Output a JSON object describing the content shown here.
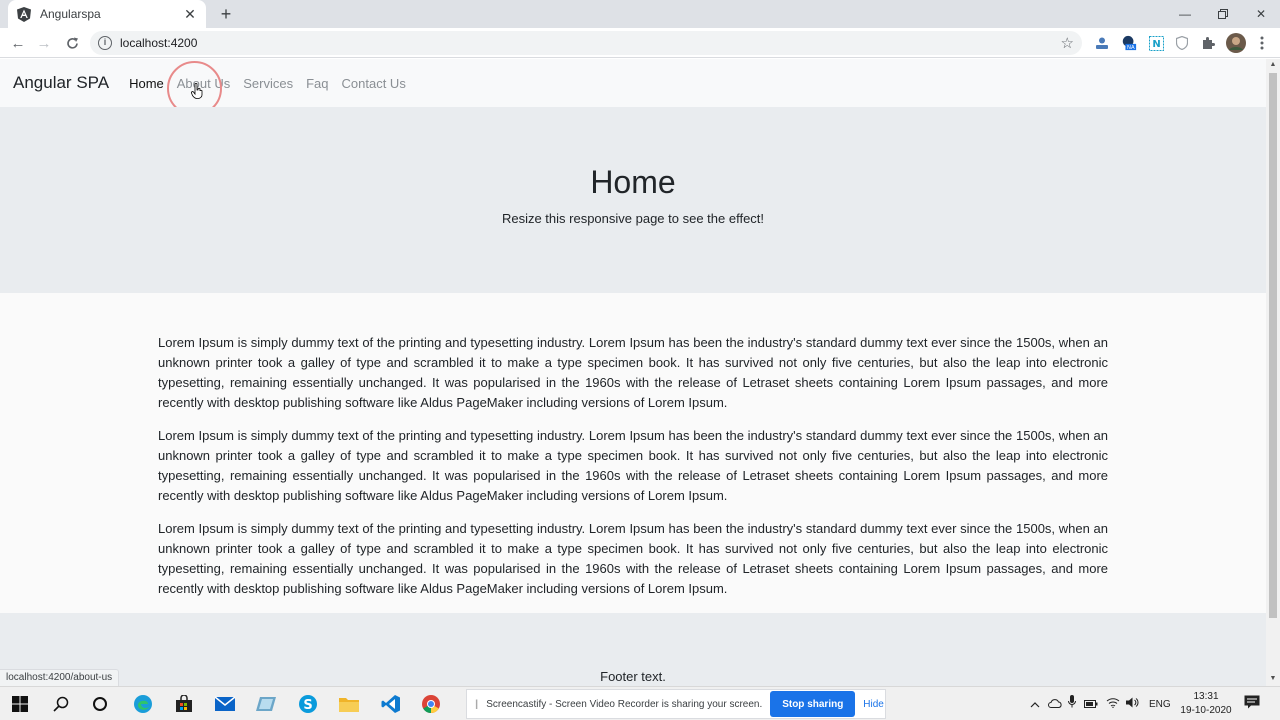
{
  "browser": {
    "tab_title": "Angularspa",
    "url": "localhost:4200",
    "status_url": "localhost:4200/about-us"
  },
  "navbar": {
    "brand": "Angular SPA",
    "links": [
      {
        "label": "Home",
        "active": true
      },
      {
        "label": "About Us",
        "active": false
      },
      {
        "label": "Services",
        "active": false
      },
      {
        "label": "Faq",
        "active": false
      },
      {
        "label": "Contact Us",
        "active": false
      }
    ]
  },
  "hero": {
    "title": "Home",
    "subtitle": "Resize this responsive page to see the effect!"
  },
  "content": {
    "paragraphs": [
      "Lorem Ipsum is simply dummy text of the printing and typesetting industry. Lorem Ipsum has been the industry's standard dummy text ever since the 1500s, when an unknown printer took a galley of type and scrambled it to make a type specimen book. It has survived not only five centuries, but also the leap into electronic typesetting, remaining essentially unchanged. It was popularised in the 1960s with the release of Letraset sheets containing Lorem Ipsum passages, and more recently with desktop publishing software like Aldus PageMaker including versions of Lorem Ipsum.",
      "Lorem Ipsum is simply dummy text of the printing and typesetting industry. Lorem Ipsum has been the industry's standard dummy text ever since the 1500s, when an unknown printer took a galley of type and scrambled it to make a type specimen book. It has survived not only five centuries, but also the leap into electronic typesetting, remaining essentially unchanged. It was popularised in the 1960s with the release of Letraset sheets containing Lorem Ipsum passages, and more recently with desktop publishing software like Aldus PageMaker including versions of Lorem Ipsum.",
      "Lorem Ipsum is simply dummy text of the printing and typesetting industry. Lorem Ipsum has been the industry's standard dummy text ever since the 1500s, when an unknown printer took a galley of type and scrambled it to make a type specimen book. It has survived not only five centuries, but also the leap into electronic typesetting, remaining essentially unchanged. It was popularised in the 1960s with the release of Letraset sheets containing Lorem Ipsum passages, and more recently with desktop publishing software like Aldus PageMaker including versions of Lorem Ipsum."
    ]
  },
  "footer": {
    "text": "Footer text."
  },
  "screen_share": {
    "message": "Screencastify - Screen Video Recorder is sharing your screen.",
    "stop_label": "Stop sharing",
    "hide_label": "Hide"
  },
  "taskbar": {
    "language": "ENG",
    "time": "13:31",
    "date": "19-10-2020",
    "pinned_icons": [
      "windows-start-icon",
      "search-icon",
      "cortana-icon",
      "edge-icon",
      "store-icon",
      "mail-icon",
      "app-icon",
      "skype-icon",
      "file-explorer-icon",
      "vscode-icon",
      "chrome-icon"
    ]
  },
  "colors": {
    "hero_bg": "#e9ecef",
    "page_bg": "#f8f9fa",
    "active_link": "#111111",
    "inactive_link": "#8a8f94",
    "share_button": "#1a73e8",
    "click_ring": "#e88a8a"
  }
}
